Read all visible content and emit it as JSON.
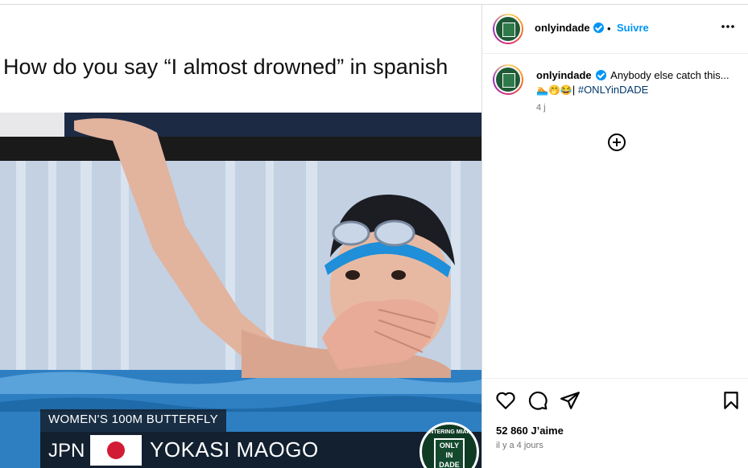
{
  "post": {
    "meme_caption": "How do you say “I almost drowned” in spanish",
    "chyron": {
      "event": "WOMEN'S 100M BUTTERFLY",
      "country": "JPN",
      "name": "YOKASI MAOGO"
    },
    "badge": {
      "arc_text": "ENTERING MIAMI",
      "lines": [
        "ONLY",
        "IN",
        "DADE"
      ]
    }
  },
  "header": {
    "username": "onlyindade",
    "separator": "•",
    "follow_label": "Suivre",
    "more_label": "•••"
  },
  "comment": {
    "username": "onlyindade",
    "text": "Anybody else catch this...",
    "emojis": "🏊🤭😂",
    "pipe": "|",
    "hashtag": "#ONLYinDADE",
    "time": "4 j"
  },
  "footer": {
    "likes": "52 860 J’aime",
    "posted": "il y a 4 jours"
  },
  "colors": {
    "accent": "#0095f6",
    "verified": "#0095f6",
    "hashtag": "#00376b",
    "muted": "#737373",
    "badge_green": "#0f3b25"
  },
  "icons": [
    "verified-icon",
    "more-icon",
    "add-comment-icon",
    "heart-icon",
    "comment-icon",
    "share-icon",
    "bookmark-icon"
  ]
}
